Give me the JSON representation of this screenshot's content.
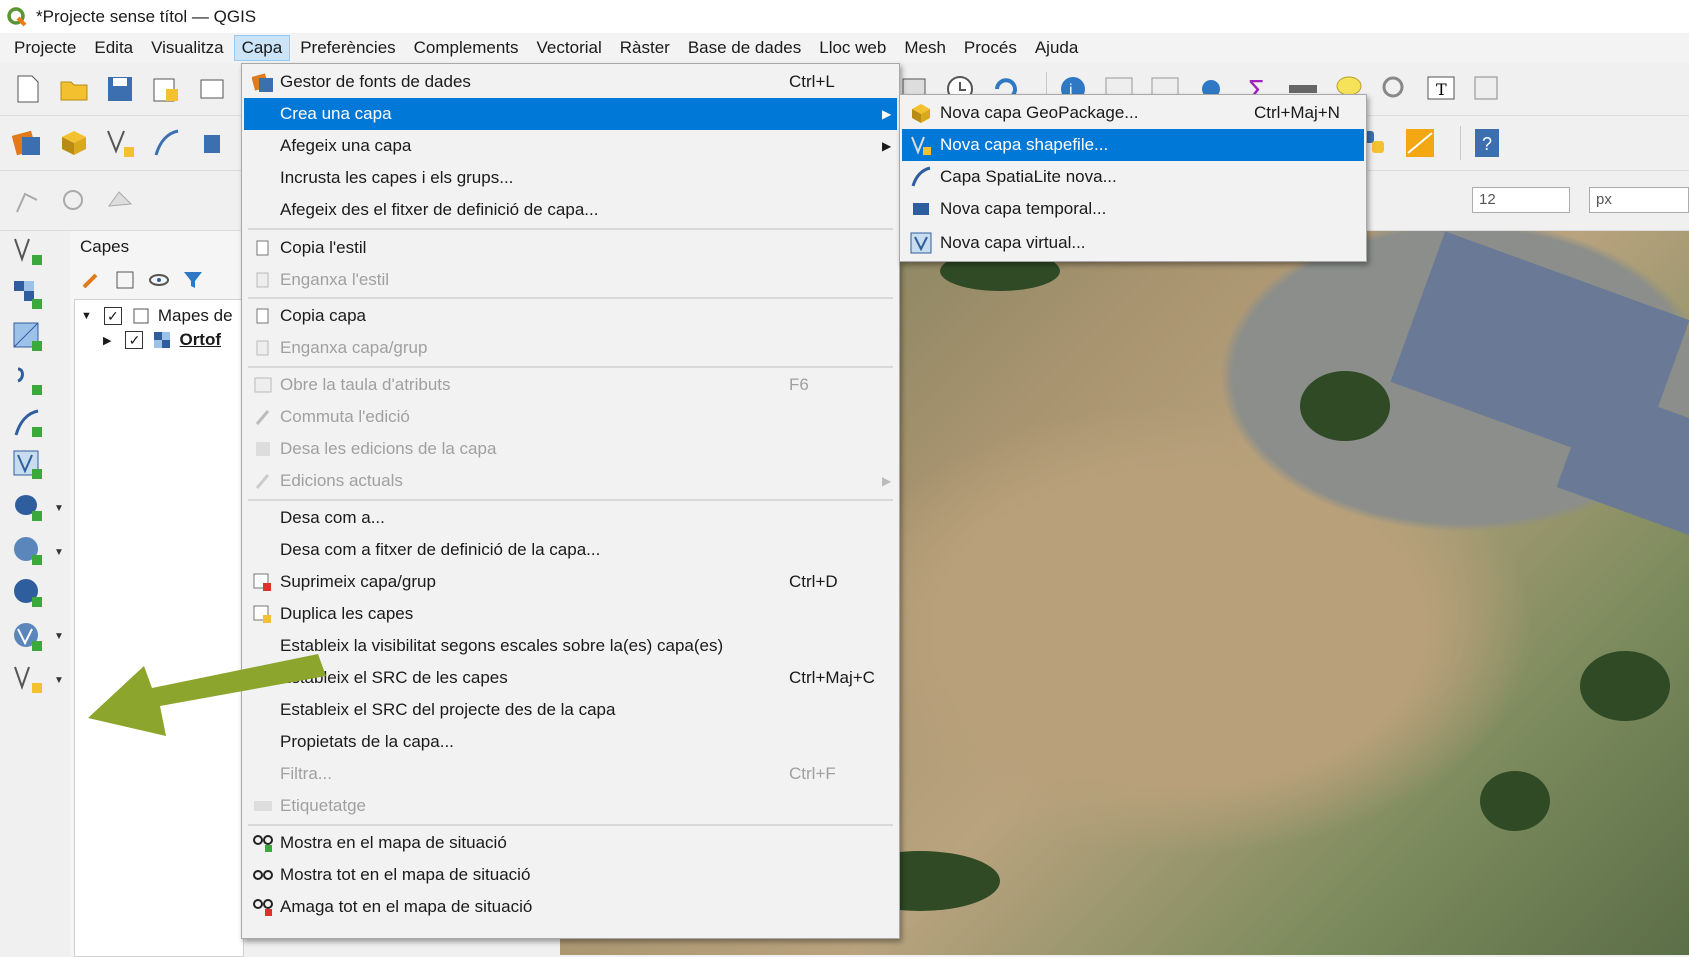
{
  "window": {
    "title": "*Projecte sense títol — QGIS"
  },
  "menubar": [
    {
      "label": "Projecte"
    },
    {
      "label": "Edita"
    },
    {
      "label": "Visualitza"
    },
    {
      "label": "Capa",
      "active": true
    },
    {
      "label": "Preferències"
    },
    {
      "label": "Complements"
    },
    {
      "label": "Vectorial"
    },
    {
      "label": "Ràster"
    },
    {
      "label": "Base de dades"
    },
    {
      "label": "Lloc web"
    },
    {
      "label": "Mesh"
    },
    {
      "label": "Procés"
    },
    {
      "label": "Ajuda"
    }
  ],
  "toolbar": {
    "size_value": "12",
    "size_unit": "px"
  },
  "layers_panel": {
    "title": "Capes",
    "group": {
      "label": "Mapes de",
      "checked": true
    },
    "layer": {
      "label": "Ortof",
      "checked": true
    }
  },
  "capa_menu": {
    "items": [
      {
        "label": "Gestor de fonts de dades",
        "shortcut": "Ctrl+L",
        "icon": "data-source-manager-icon"
      },
      {
        "label": "Crea una capa",
        "submenu": true,
        "selected": true
      },
      {
        "label": "Afegeix una capa",
        "submenu": true
      },
      {
        "label": "Incrusta les capes i els grups..."
      },
      {
        "label": "Afegeix des el fitxer de definició de capa..."
      },
      {
        "label": "Copia l'estil",
        "icon": "copy-style-icon"
      },
      {
        "label": "Enganxa l'estil",
        "disabled": true,
        "icon": "paste-style-icon"
      },
      {
        "label": "Copia capa",
        "icon": "copy-layer-icon"
      },
      {
        "label": "Enganxa capa/grup",
        "disabled": true,
        "icon": "paste-layer-icon"
      },
      {
        "label": "Obre la taula d'atributs",
        "shortcut": "F6",
        "disabled": true,
        "icon": "attribute-table-icon"
      },
      {
        "label": "Commuta l'edició",
        "disabled": true,
        "icon": "toggle-edit-icon"
      },
      {
        "label": "Desa les edicions de la capa",
        "disabled": true,
        "icon": "save-edits-icon"
      },
      {
        "label": "Edicions actuals",
        "disabled": true,
        "submenu": true,
        "icon": "current-edits-icon"
      },
      {
        "label": "Desa com a..."
      },
      {
        "label": "Desa com a fitxer de definició de la capa..."
      },
      {
        "label": "Suprimeix capa/grup",
        "shortcut": "Ctrl+D",
        "icon": "remove-layer-icon"
      },
      {
        "label": "Duplica les capes",
        "icon": "duplicate-layer-icon"
      },
      {
        "label": "Estableix la visibilitat segons escales sobre la(es) capa(es)"
      },
      {
        "label": "Estableix el SRC de les capes",
        "shortcut": "Ctrl+Maj+C"
      },
      {
        "label": "Estableix el SRC del projecte des de la capa"
      },
      {
        "label": "Propietats de la capa..."
      },
      {
        "label": "Filtra...",
        "shortcut": "Ctrl+F",
        "disabled": true
      },
      {
        "label": "Etiquetatge",
        "disabled": true,
        "icon": "labeling-icon"
      },
      {
        "label": "Mostra en el mapa de situació",
        "icon": "overview-show-icon"
      },
      {
        "label": "Mostra tot en el mapa de situació",
        "icon": "overview-show-all-icon"
      },
      {
        "label": "Amaga tot en el mapa de situació",
        "icon": "overview-hide-all-icon"
      }
    ]
  },
  "crea_submenu": {
    "items": [
      {
        "label": "Nova capa GeoPackage...",
        "shortcut": "Ctrl+Maj+N",
        "icon": "geopackage-icon"
      },
      {
        "label": "Nova capa shapefile...",
        "selected": true,
        "icon": "shapefile-icon"
      },
      {
        "label": "Capa SpatiaLite nova...",
        "icon": "spatialite-icon"
      },
      {
        "label": "Nova capa temporal...",
        "icon": "temporary-layer-icon"
      },
      {
        "label": "Nova capa virtual...",
        "icon": "virtual-layer-icon"
      }
    ]
  },
  "colors": {
    "selection": "#0078d7",
    "arrow": "#8ca52c"
  }
}
